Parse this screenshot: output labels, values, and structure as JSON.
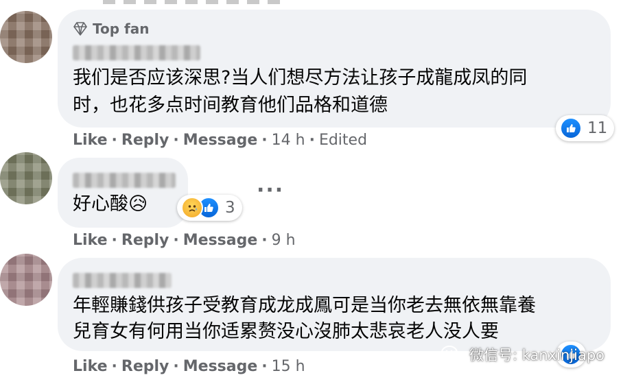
{
  "comments": [
    {
      "badge": "Top fan",
      "text_lines": [
        "我们是否应该深思?当人们想尽方法让孩子成龍成凤的同",
        "时，也花多点时间教育他们品格和道德"
      ],
      "actions": {
        "like": "Like",
        "reply": "Reply",
        "message": "Message",
        "time": "14 h",
        "edited": "Edited"
      },
      "reactions": {
        "count": "11",
        "types": [
          "like-icon"
        ]
      }
    },
    {
      "text_lines": [
        "好心酸😥"
      ],
      "actions": {
        "like": "Like",
        "reply": "Reply",
        "message": "Message",
        "time": "9 h"
      },
      "reactions": {
        "count": "3",
        "types": [
          "sad-icon",
          "like-icon"
        ]
      },
      "more": "···"
    },
    {
      "text_lines": [
        "年輕賺錢供孩子受教育成龙成鳳可是当你老去無依無靠養",
        "兒育女有何用当你适累赘没心沒肺太悲哀老人没人要"
      ],
      "actions": {
        "like": "Like",
        "reply": "Reply",
        "message": "Message",
        "time": "15 h"
      }
    }
  ],
  "separator": "·",
  "watermark": {
    "text": "微信号: kanxinjiapo",
    "icon": "wechat-icon"
  },
  "colors": {
    "bubble": "#f0f2f5",
    "meta": "#65676b",
    "like_blue": "#1877f2"
  }
}
